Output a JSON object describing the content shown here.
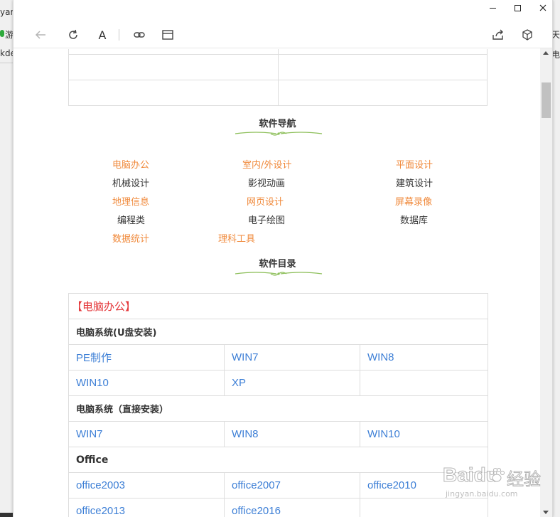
{
  "background_window": {
    "left_fragments": [
      "yar",
      "游",
      "kde"
    ],
    "right_fragments": [
      "天",
      "电"
    ]
  },
  "toolbar": {
    "font_label": "A"
  },
  "sections": {
    "nav_title": "软件导航",
    "dir_title": "软件目录"
  },
  "nav": [
    {
      "label": "电脑办公",
      "style": "orange"
    },
    {
      "label": "室内/外设计",
      "style": "orange"
    },
    {
      "label": "平面设计",
      "style": "orange"
    },
    {
      "label": "机械设计",
      "style": "dark"
    },
    {
      "label": "影视动画",
      "style": "dark"
    },
    {
      "label": "建筑设计",
      "style": "dark"
    },
    {
      "label": "地理信息",
      "style": "orange"
    },
    {
      "label": "网页设计",
      "style": "orange"
    },
    {
      "label": "屏幕录像",
      "style": "orange"
    },
    {
      "label": "编程类",
      "style": "dark"
    },
    {
      "label": "电子绘图",
      "style": "dark"
    },
    {
      "label": "数据库",
      "style": "dark"
    },
    {
      "label": "数据统计",
      "style": "orange"
    },
    {
      "label": "理科工具",
      "style": "orange"
    }
  ],
  "directory": {
    "category": "【电脑办公】",
    "groups": [
      {
        "title": "电脑系统(U盘安装)",
        "rows": [
          [
            "PE制作",
            "WIN7",
            "WIN8"
          ],
          [
            "WIN10",
            "XP",
            ""
          ]
        ]
      },
      {
        "title": "电脑系统（直接安装）",
        "rows": [
          [
            "WIN7",
            "WIN8",
            "WIN10"
          ]
        ]
      },
      {
        "title": "Office",
        "rows": [
          [
            "office2003",
            "office2007",
            "office2010"
          ],
          [
            "office2013",
            "office2016",
            ""
          ]
        ]
      }
    ]
  },
  "watermark": {
    "brand": "Baidu",
    "brand_cn": "经验",
    "url": "jingyan.baidu.com"
  },
  "colors": {
    "nav_orange": "#f08a3c",
    "link_blue": "#3d7fd6",
    "category_red": "#e4393c",
    "ornament_green": "#8dbf5a"
  }
}
